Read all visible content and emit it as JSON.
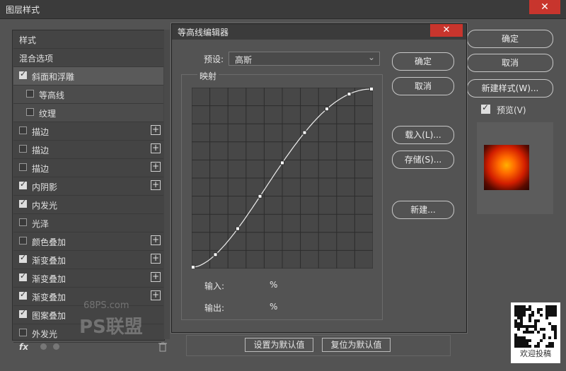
{
  "main": {
    "title": "图层样式",
    "close": "✕",
    "list": [
      {
        "label": "样式",
        "check": "none"
      },
      {
        "label": "混合选项",
        "check": "none"
      },
      {
        "label": "斜面和浮雕",
        "check": "on",
        "selected": true
      },
      {
        "label": "等高线",
        "check": "off",
        "sub": true
      },
      {
        "label": "纹理",
        "check": "off",
        "sub": true
      },
      {
        "label": "描边",
        "check": "off",
        "plus": true
      },
      {
        "label": "描边",
        "check": "off",
        "plus": true
      },
      {
        "label": "描边",
        "check": "off",
        "plus": true
      },
      {
        "label": "内阴影",
        "check": "on",
        "plus": true
      },
      {
        "label": "内发光",
        "check": "on"
      },
      {
        "label": "光泽",
        "check": "off"
      },
      {
        "label": "颜色叠加",
        "check": "off",
        "plus": true
      },
      {
        "label": "渐变叠加",
        "check": "on",
        "plus": true
      },
      {
        "label": "渐变叠加",
        "check": "on",
        "plus": true
      },
      {
        "label": "渐变叠加",
        "check": "on",
        "plus": true
      },
      {
        "label": "图案叠加",
        "check": "on"
      },
      {
        "label": "外发光",
        "check": "off"
      }
    ],
    "fx_label": "fx",
    "ok": "确定",
    "cancel": "取消",
    "new_style": "新建样式(W)...",
    "preview_label": "预览(V)",
    "set_default": "设置为默认值",
    "reset_default": "复位为默认值"
  },
  "contour": {
    "title": "等高线编辑器",
    "close": "✕",
    "preset_label": "预设:",
    "preset_value": "高斯",
    "mapping_label": "映射",
    "input_label": "输入:",
    "output_label": "输出:",
    "percent": "%",
    "ok": "确定",
    "cancel": "取消",
    "load": "载入(L)...",
    "save": "存储(S)...",
    "new": "新建..."
  },
  "watermark": {
    "site": "68PS.com",
    "brand": "PS联盟",
    "submit": "欢迎投稿"
  }
}
